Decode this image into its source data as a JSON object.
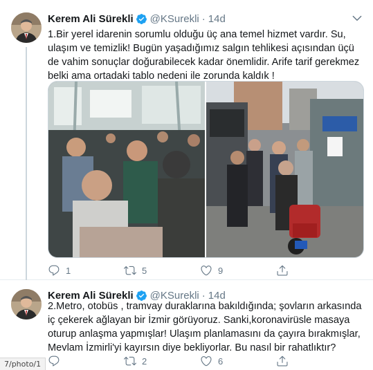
{
  "colors": {
    "accent": "#1da1f2",
    "secondary_text": "#657786",
    "border": "#e6ecf0"
  },
  "tweets": [
    {
      "author_name": "Kerem Ali Sürekli",
      "handle": "@KSurekli",
      "separator": "·",
      "time": "14d",
      "text": "1.Bir yerel idarenin sorumlu olduğu üç ana temel hizmet vardır. Su, ulaşım ve temizlik! Bugün yaşadığımız salgın tehlikesi açısından üçü de vahim sonuçlar doğurabilecek kadar önemlidir. Arife tarif gerekmez belki ama ortadaki tablo nedeni ile  zorunda kaldık !",
      "media": [
        {
          "icon": "crowded-metrobus-photo"
        },
        {
          "icon": "crowded-bus-stop-photo"
        }
      ],
      "actions": {
        "reply_count": "1",
        "retweet_count": "5",
        "like_count": "9",
        "share_count": ""
      }
    },
    {
      "author_name": "Kerem Ali Sürekli",
      "handle": "@KSurekli",
      "separator": "·",
      "time": "14d",
      "text": "2.Metro, otobüs , tramvay duraklarına bakıldığında; şovların arkasında  iç çekerek ağlayan bir İzmir görüyoruz. Sanki,koronavirüsle masaya oturup anlaşma yapmışlar! Ulaşım planlamasını da çayıra bırakmışlar, Mevlam İzmirli'yi kayırsın diye bekliyorlar.  Bu nasıl bir rahatlıktır?",
      "actions": {
        "reply_count": "",
        "retweet_count": "2",
        "like_count": "6",
        "share_count": ""
      }
    }
  ],
  "status_bar": {
    "url": "7/photo/1"
  }
}
